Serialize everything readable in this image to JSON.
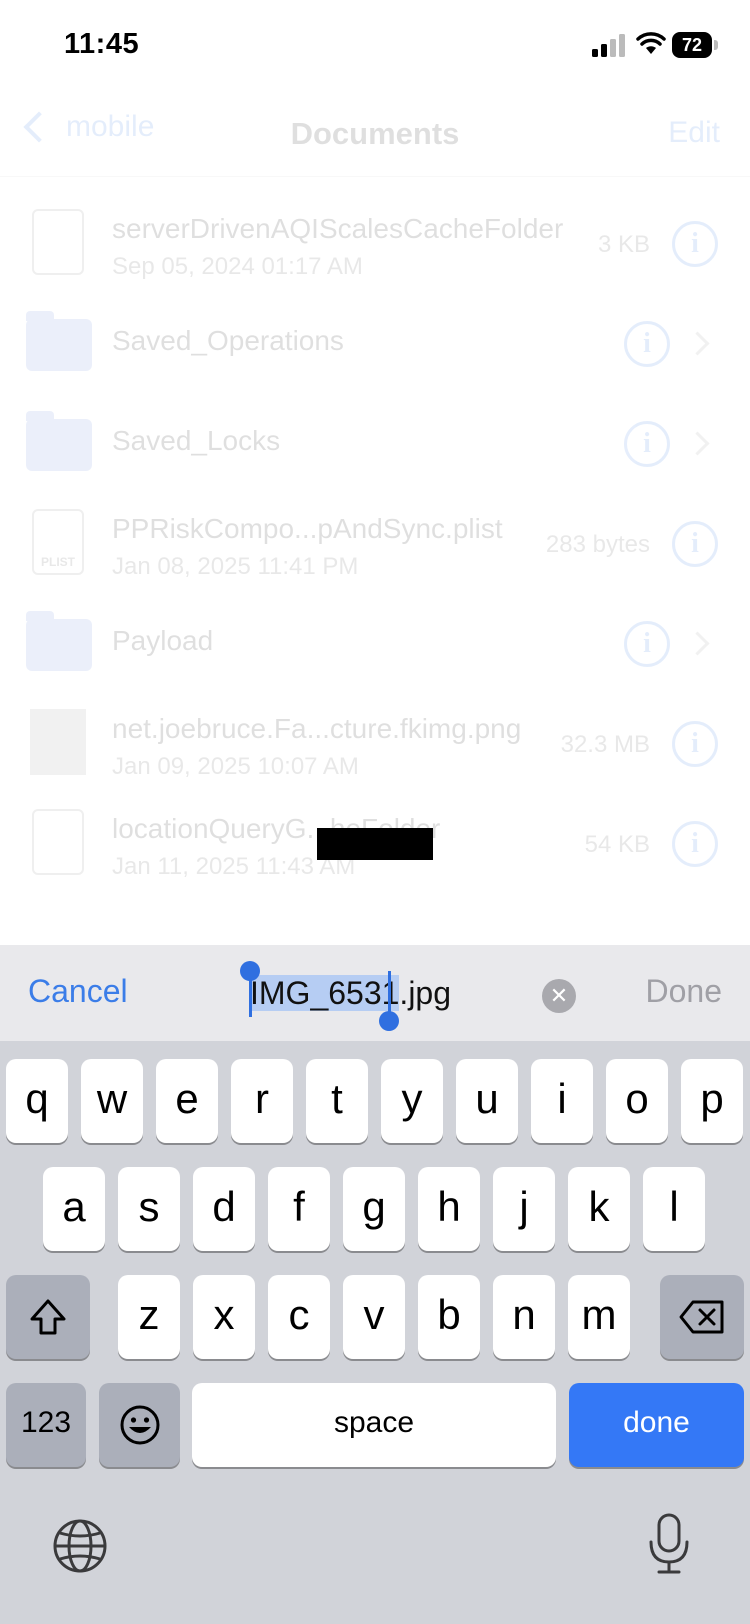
{
  "status_bar": {
    "time": "11:45",
    "battery": "72"
  },
  "nav": {
    "back_label": "mobile",
    "title": "Documents",
    "edit_label": "Edit"
  },
  "files": [
    {
      "name": "serverDrivenAQIScalesCacheFolder",
      "date": "Sep 05, 2024 01:17 AM",
      "size": "3 KB",
      "kind": "doc"
    },
    {
      "name": "Saved_Operations",
      "kind": "folder"
    },
    {
      "name": "Saved_Locks",
      "kind": "folder"
    },
    {
      "name": "PPRiskCompo...pAndSync.plist",
      "date": "Jan 08, 2025 11:41 PM",
      "size": "283 bytes",
      "kind": "plist",
      "badge": "PLIST"
    },
    {
      "name": "Payload",
      "kind": "folder"
    },
    {
      "name": "net.joebruce.Fa...cture.fkimg.png",
      "date": "Jan 09, 2025 10:07 AM",
      "size": "32.3 MB",
      "kind": "image"
    },
    {
      "name": "locationQueryG...heFolder",
      "date": "Jan 11, 2025 11:43 AM",
      "size": "54 KB",
      "kind": "doc"
    }
  ],
  "rename": {
    "cancel_label": "Cancel",
    "selected_text": "IMG_6531",
    "rest_text": ".jpg",
    "clear_icon": "✕",
    "done_label": "Done"
  },
  "keyboard": {
    "row1": [
      "q",
      "w",
      "e",
      "r",
      "t",
      "y",
      "u",
      "i",
      "o",
      "p"
    ],
    "row2": [
      "a",
      "s",
      "d",
      "f",
      "g",
      "h",
      "j",
      "k",
      "l"
    ],
    "row3": [
      "z",
      "x",
      "c",
      "v",
      "b",
      "n",
      "m"
    ],
    "numbers_label": "123",
    "space_label": "space",
    "done_label": "done"
  }
}
